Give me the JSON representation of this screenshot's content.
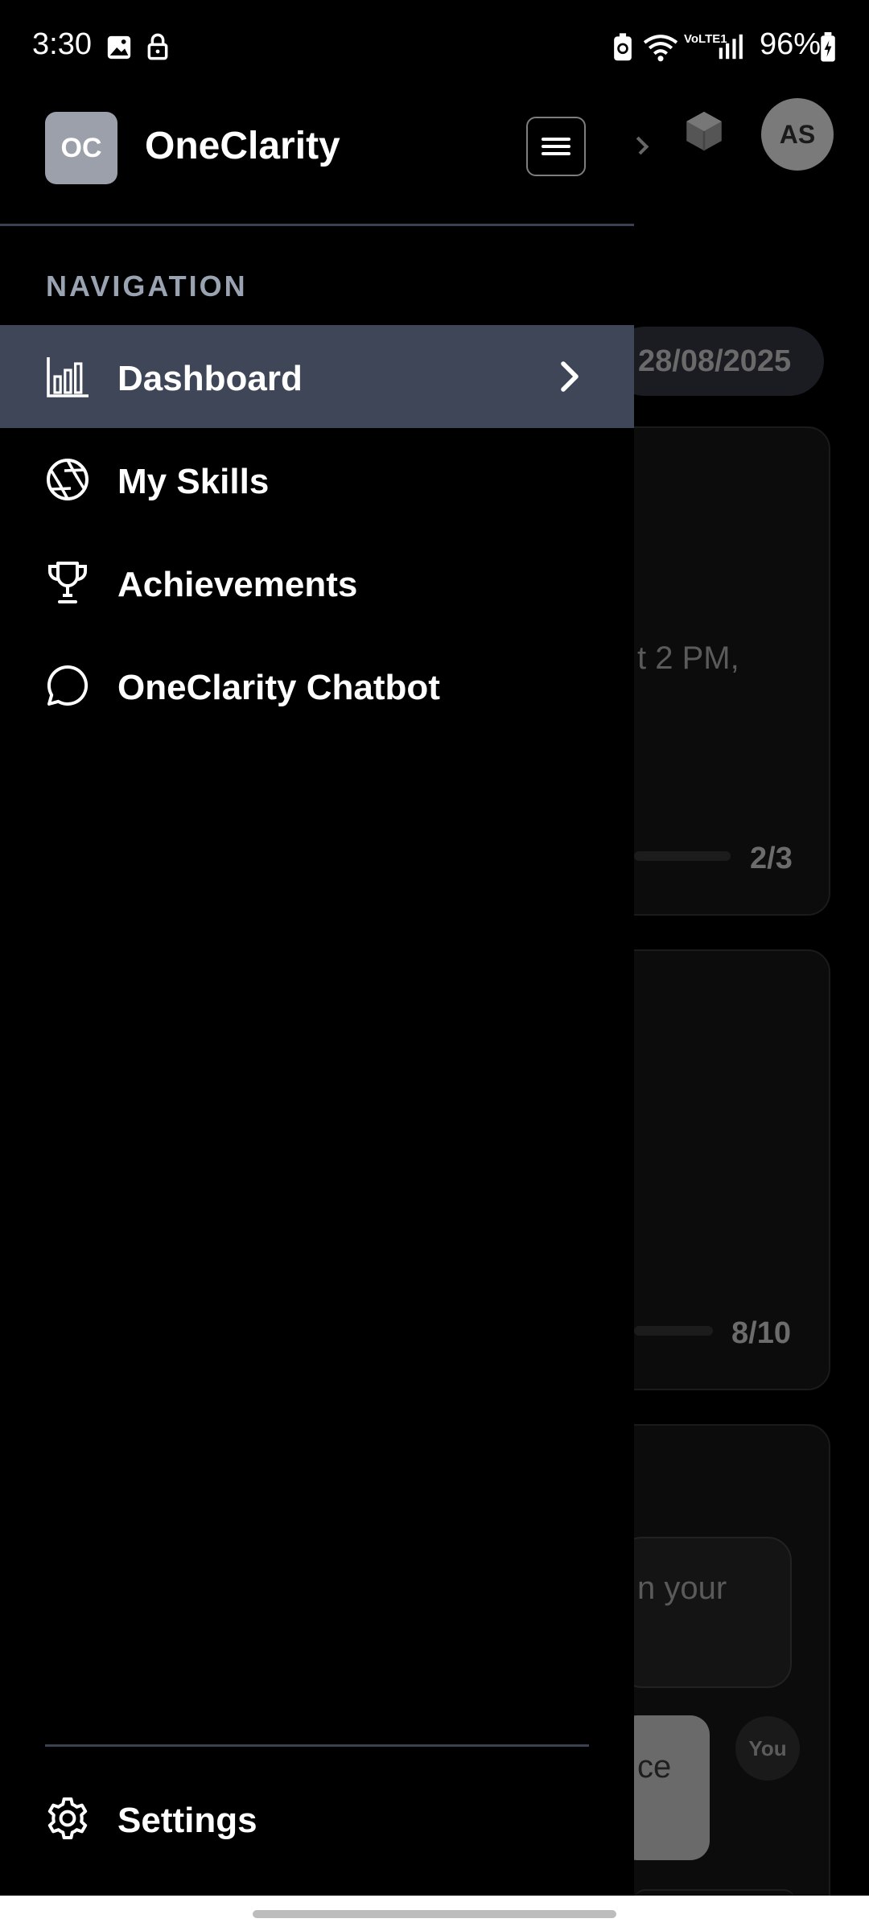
{
  "status_bar": {
    "time": "3:30",
    "battery": "96%",
    "network_label": "VoLTE1"
  },
  "drawer": {
    "logo_initials": "OC",
    "app_name": "OneClarity",
    "section_label": "NAVIGATION",
    "items": [
      {
        "label": "Dashboard",
        "icon": "bar-chart-icon",
        "active": true
      },
      {
        "label": "My Skills",
        "icon": "aperture-icon",
        "active": false
      },
      {
        "label": "Achievements",
        "icon": "trophy-icon",
        "active": false
      },
      {
        "label": "OneClarity Chatbot",
        "icon": "chat-bubble-icon",
        "active": false
      }
    ],
    "settings_label": "Settings"
  },
  "background": {
    "avatar_initials": "AS",
    "date_pill": "28/08/2025",
    "card1_text": "t 2 PM,",
    "card1_progress": "2/3",
    "card2_progress": "8/10",
    "chat_bot_text": "n your",
    "chat_user_text": "ce",
    "chat_user_avatar": "You"
  },
  "colors": {
    "drawer_bg": "#000000",
    "active_item_bg": "#3e4657",
    "section_label": "#9aa3b2",
    "logo_bg": "#9ca0ab"
  }
}
